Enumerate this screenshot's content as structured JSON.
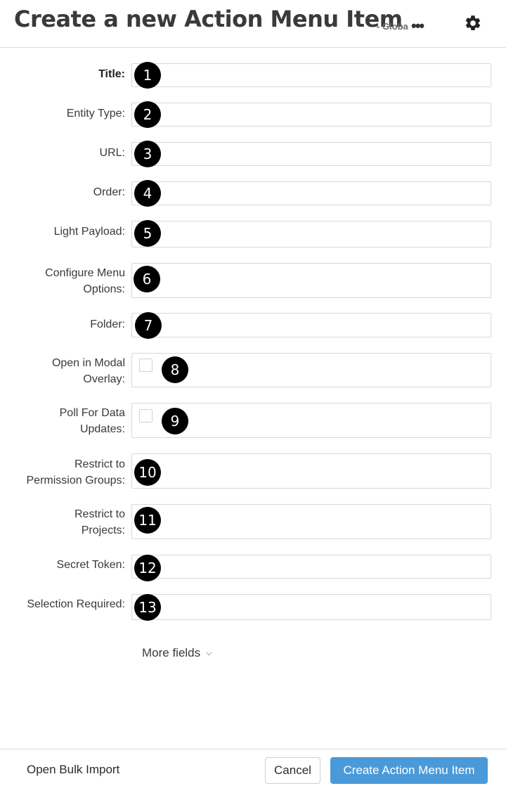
{
  "header": {
    "title": "Create a new Action Menu Item",
    "subtitle": "- Globa",
    "ellipsis": "•••",
    "settings_icon": "gear-icon"
  },
  "fields": [
    {
      "label": "Title:",
      "badge": "1"
    },
    {
      "label": "Entity Type:",
      "badge": "2"
    },
    {
      "label": "URL:",
      "badge": "3"
    },
    {
      "label": "Order:",
      "badge": "4"
    },
    {
      "label": "Light Payload:",
      "badge": "5"
    },
    {
      "label_line1": "Configure Menu",
      "label_line2": "Options:",
      "badge": "6"
    },
    {
      "label": "Folder:",
      "badge": "7"
    },
    {
      "label_line1": "Open in Modal",
      "label_line2": "Overlay:",
      "badge": "8"
    },
    {
      "label_line1": "Poll For Data",
      "label_line2": "Updates:",
      "badge": "9"
    },
    {
      "label_line1": "Restrict to",
      "label_line2": "Permission Groups:",
      "badge": "10"
    },
    {
      "label_line1": "Restrict to",
      "label_line2": "Projects:",
      "badge": "11"
    },
    {
      "label": "Secret Token:",
      "badge": "12"
    },
    {
      "label": "Selection Required:",
      "badge": "13"
    }
  ],
  "more_fields": {
    "label": "More fields",
    "icon": "chevron-down-icon"
  },
  "footer": {
    "bulk_import": "Open Bulk Import",
    "cancel": "Cancel",
    "create": "Create Action Menu Item"
  },
  "colors": {
    "primary_button": "#4a9ad9",
    "badge": "#000000"
  }
}
